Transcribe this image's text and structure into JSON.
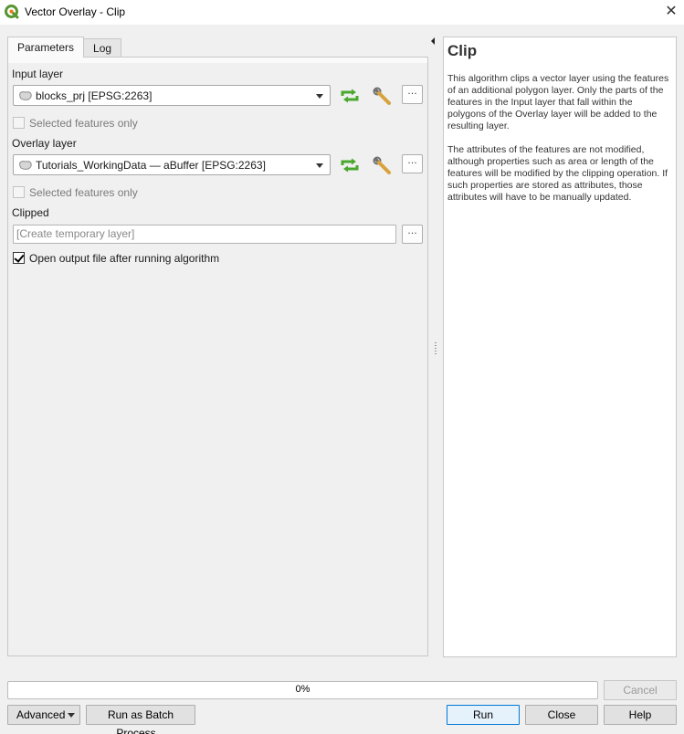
{
  "window": {
    "title": "Vector Overlay - Clip",
    "close_glyph": "✕"
  },
  "tabs": [
    {
      "label": "Parameters",
      "active": true
    },
    {
      "label": "Log",
      "active": false
    }
  ],
  "params": {
    "input_layer_label": "Input layer",
    "input_layer_value": "blocks_prj [EPSG:2263]",
    "input_selected_only": "Selected features only",
    "input_selected_checked": false,
    "overlay_layer_label": "Overlay layer",
    "overlay_layer_value": "Tutorials_WorkingData — aBuffer [EPSG:2263]",
    "overlay_selected_only": "Selected features only",
    "overlay_selected_checked": false,
    "clipped_label": "Clipped",
    "clipped_placeholder": "[Create temporary layer]",
    "open_output_label": "Open output file after running algorithm",
    "open_output_checked": true,
    "dots_label": "…"
  },
  "help": {
    "title": "Clip",
    "paragraph1": "This algorithm clips a vector layer using the features of an additional polygon layer. Only the parts of the features in the Input layer that fall within the polygons of the Overlay layer will be added to the resulting layer.",
    "paragraph2": "The attributes of the features are not modified, although properties such as area or length of the features will be modified by the clipping operation. If such properties are stored as attributes, those attributes will have to be manually updated."
  },
  "progress": {
    "value": 0,
    "text": "0%"
  },
  "buttons": {
    "cancel": "Cancel",
    "advanced": "Advanced",
    "batch": "Run as Batch Process...",
    "run": "Run",
    "close": "Close",
    "help": "Help"
  },
  "colors": {
    "accent": "#0078d7",
    "qgis_green": "#589632",
    "iterate_green": "#4aa82e"
  },
  "icons": {
    "app": "qgis-logo-icon",
    "layer": "polygon-layer-icon",
    "iterate": "iterate-icon",
    "wrench": "wrench-icon"
  }
}
